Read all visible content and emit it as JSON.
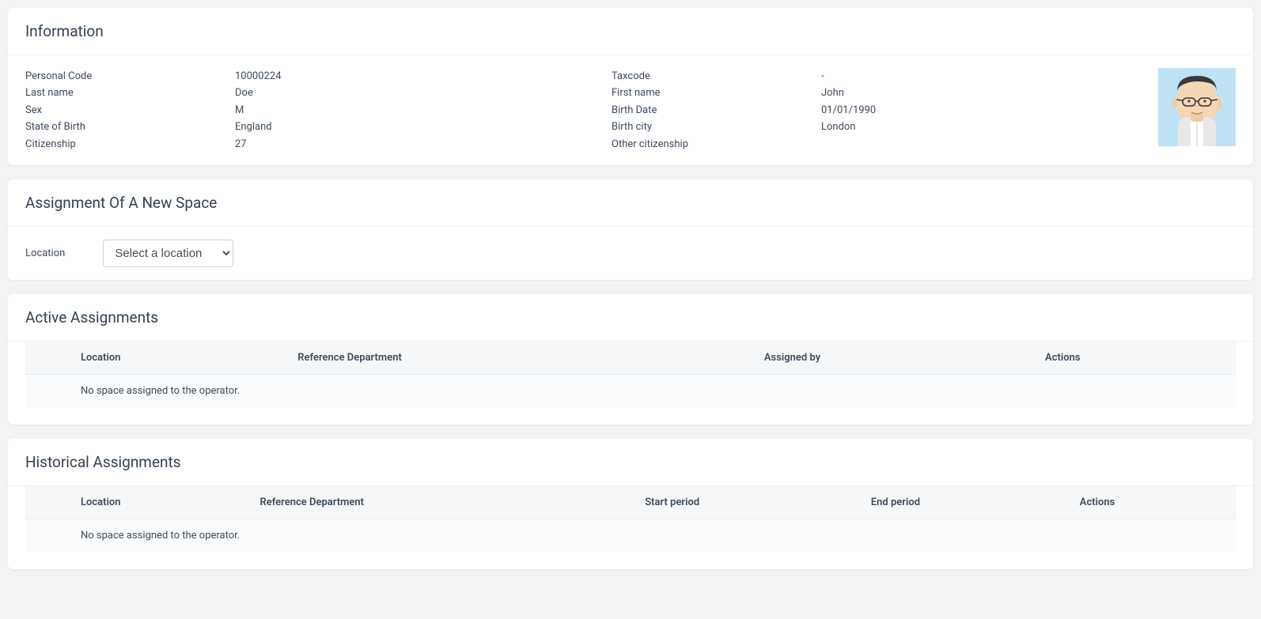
{
  "information": {
    "title": "Information",
    "rowsLeft": [
      {
        "label": "Personal Code",
        "value": "10000224"
      },
      {
        "label": "Last name",
        "value": "Doe"
      },
      {
        "label": "Sex",
        "value": "M"
      },
      {
        "label": "State of Birth",
        "value": "England"
      },
      {
        "label": "Citizenship",
        "value": "27"
      }
    ],
    "rowsRight": [
      {
        "label": "Taxcode",
        "value": "-"
      },
      {
        "label": "First name",
        "value": "John"
      },
      {
        "label": "Birth Date",
        "value": "01/01/1990"
      },
      {
        "label": "Birth city",
        "value": "London"
      },
      {
        "label": "Other citizenship",
        "value": ""
      }
    ]
  },
  "assignment": {
    "title": "Assignment Of A New Space",
    "locationLabel": "Location",
    "selectPlaceholder": "Select a location"
  },
  "activeAssignments": {
    "title": "Active Assignments",
    "headers": {
      "c0": "",
      "c1": "Location",
      "c2": "Reference Department",
      "c3": "Assigned by",
      "c4": "Actions"
    },
    "emptyMessage": "No space assigned to the operator."
  },
  "historicalAssignments": {
    "title": "Historical Assignments",
    "headers": {
      "c0": "",
      "c1": "Location",
      "c2": "Reference Department",
      "c3": "Start period",
      "c4": "End period",
      "c5": "Actions"
    },
    "emptyMessage": "No space assigned to the operator."
  }
}
